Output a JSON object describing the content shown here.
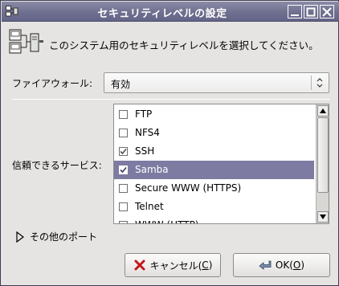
{
  "window": {
    "title": "セキュリティレベルの設定"
  },
  "header": {
    "text": "このシステム用のセキュリティレベルを選択してください。",
    "icon": "server-network-icon"
  },
  "firewall": {
    "label": "ファイアウォール:",
    "value": "有効"
  },
  "services": {
    "label": "信頼できるサービス:",
    "items": [
      {
        "label": "FTP",
        "checked": false,
        "selected": false
      },
      {
        "label": "NFS4",
        "checked": false,
        "selected": false
      },
      {
        "label": "SSH",
        "checked": true,
        "selected": false
      },
      {
        "label": "Samba",
        "checked": true,
        "selected": true
      },
      {
        "label": "Secure WWW (HTTPS)",
        "checked": false,
        "selected": false
      },
      {
        "label": "Telnet",
        "checked": false,
        "selected": false
      },
      {
        "label": "WWW (HTTP)",
        "checked": false,
        "selected": false
      }
    ]
  },
  "other_ports": {
    "label": "その他のポート"
  },
  "buttons": {
    "cancel": {
      "prefix": "キャンセル(",
      "mnemonic": "C",
      "suffix": ")"
    },
    "ok": {
      "prefix": "OK(",
      "mnemonic": "O",
      "suffix": ")"
    }
  },
  "colors": {
    "titlebar": "#6f6f8f",
    "selection": "#7d7ba1",
    "cancel_icon": "#c0171b"
  }
}
